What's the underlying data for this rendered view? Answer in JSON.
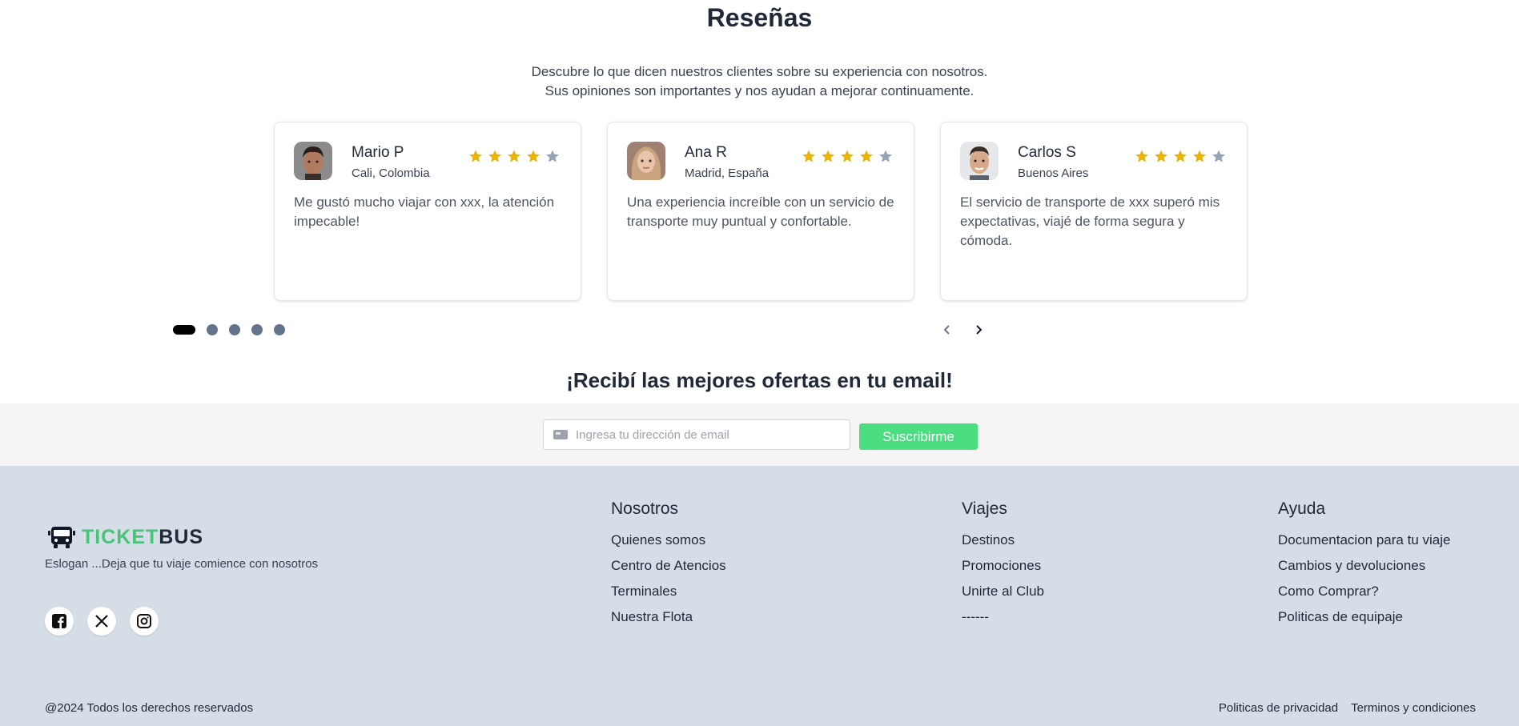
{
  "reviews": {
    "title": "Reseñas",
    "description_line1": "Descubre lo que dicen nuestros clientes sobre su experiencia con nosotros.",
    "description_line2": "Sus opiniones son importantes y nos ayudan a mejorar continuamente.",
    "cards": [
      {
        "name": "Mario P",
        "location": "Cali, Colombia",
        "rating": 4,
        "max_rating": 5,
        "text": "Me gustó mucho viajar con xxx, la atención impecable!"
      },
      {
        "name": "Ana R",
        "location": "Madrid, España",
        "rating": 4,
        "max_rating": 5,
        "text": "Una experiencia increíble con un servicio de transporte muy puntual y confortable."
      },
      {
        "name": "Carlos S",
        "location": "Buenos Aires",
        "rating": 4,
        "max_rating": 5,
        "text": "El servicio de transporte de xxx superó mis expectativas, viajé de forma segura y cómoda."
      }
    ],
    "pagination": {
      "total": 5,
      "active": 1
    },
    "star_color": "#eab308",
    "star_empty_color": "#94a3b8"
  },
  "newsletter": {
    "title": "¡Recibí las mejores ofertas en tu email!",
    "email_placeholder": "Ingresa tu dirección de email",
    "email_icon": "mail-icon",
    "subscribe_label": "Suscribirme",
    "button_color": "#4ade80"
  },
  "footer": {
    "logo_icon": "bus-icon",
    "logo_ticket": "TICKET",
    "logo_bus": "BUS",
    "slogan": "Eslogan ...Deja que tu viaje comience con nosotros",
    "socials": [
      "facebook-icon",
      "x-icon",
      "instagram-icon"
    ],
    "columns": {
      "nosotros": {
        "title": "Nosotros",
        "items": [
          "Quienes somos",
          "Centro de Atencios",
          "Terminales",
          "Nuestra Flota"
        ]
      },
      "viajes": {
        "title": "Viajes",
        "items": [
          "Destinos",
          "Promociones",
          "Unirte al Club",
          "------"
        ]
      },
      "ayuda": {
        "title": "Ayuda",
        "items": [
          "Documentacion para tu viaje",
          "Cambios y devoluciones",
          "Como Comprar?",
          "Politicas de equipaje"
        ]
      }
    },
    "copyright": "@2024 Todos los derechos reservados",
    "privacy": "Politicas de privacidad",
    "terms": "Terminos y condiciones",
    "background": "#d5dde7",
    "brand_green": "#4ac27a"
  }
}
